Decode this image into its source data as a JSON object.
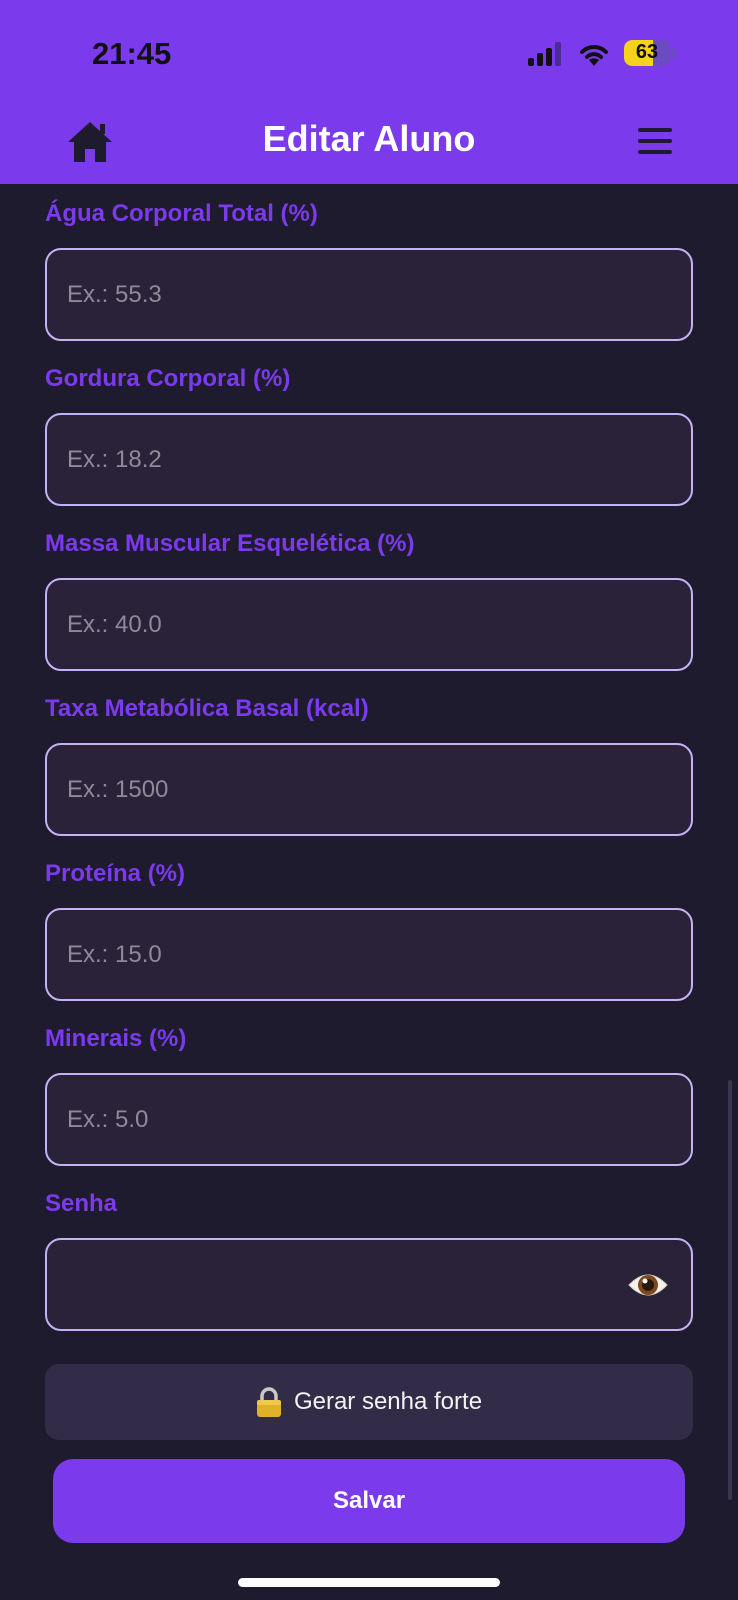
{
  "status_bar": {
    "time": "21:45",
    "battery": "63",
    "battery_level": 0.63
  },
  "header": {
    "title": "Editar Aluno",
    "home_icon": "home-icon",
    "menu_icon": "hamburger-menu-icon",
    "background": "#7c3aed"
  },
  "fields": [
    {
      "label": "Água Corporal Total (%)",
      "placeholder": "Ex.: 55.3"
    },
    {
      "label": "Gordura Corporal (%)",
      "placeholder": "Ex.: 18.2"
    },
    {
      "label": "Massa Muscular Esquelética (%)",
      "placeholder": "Ex.: 40.0"
    },
    {
      "label": "Taxa Metabólica Basal (kcal)",
      "placeholder": "Ex.: 1500"
    },
    {
      "label": "Proteína (%)",
      "placeholder": "Ex.: 15.0"
    },
    {
      "label": "Minerais (%)",
      "placeholder": "Ex.: 5.0"
    }
  ],
  "password": {
    "label": "Senha",
    "value": "",
    "toggle_icon": "eye-icon"
  },
  "generate_button": {
    "label": "Gerar senha forte",
    "icon": "lock-icon"
  },
  "save_button": {
    "label": "Salvar"
  },
  "colors": {
    "accent": "#7c3aed",
    "background": "#1e1b2e",
    "input_background": "#2a2238",
    "input_border": "#c4b2f5"
  }
}
